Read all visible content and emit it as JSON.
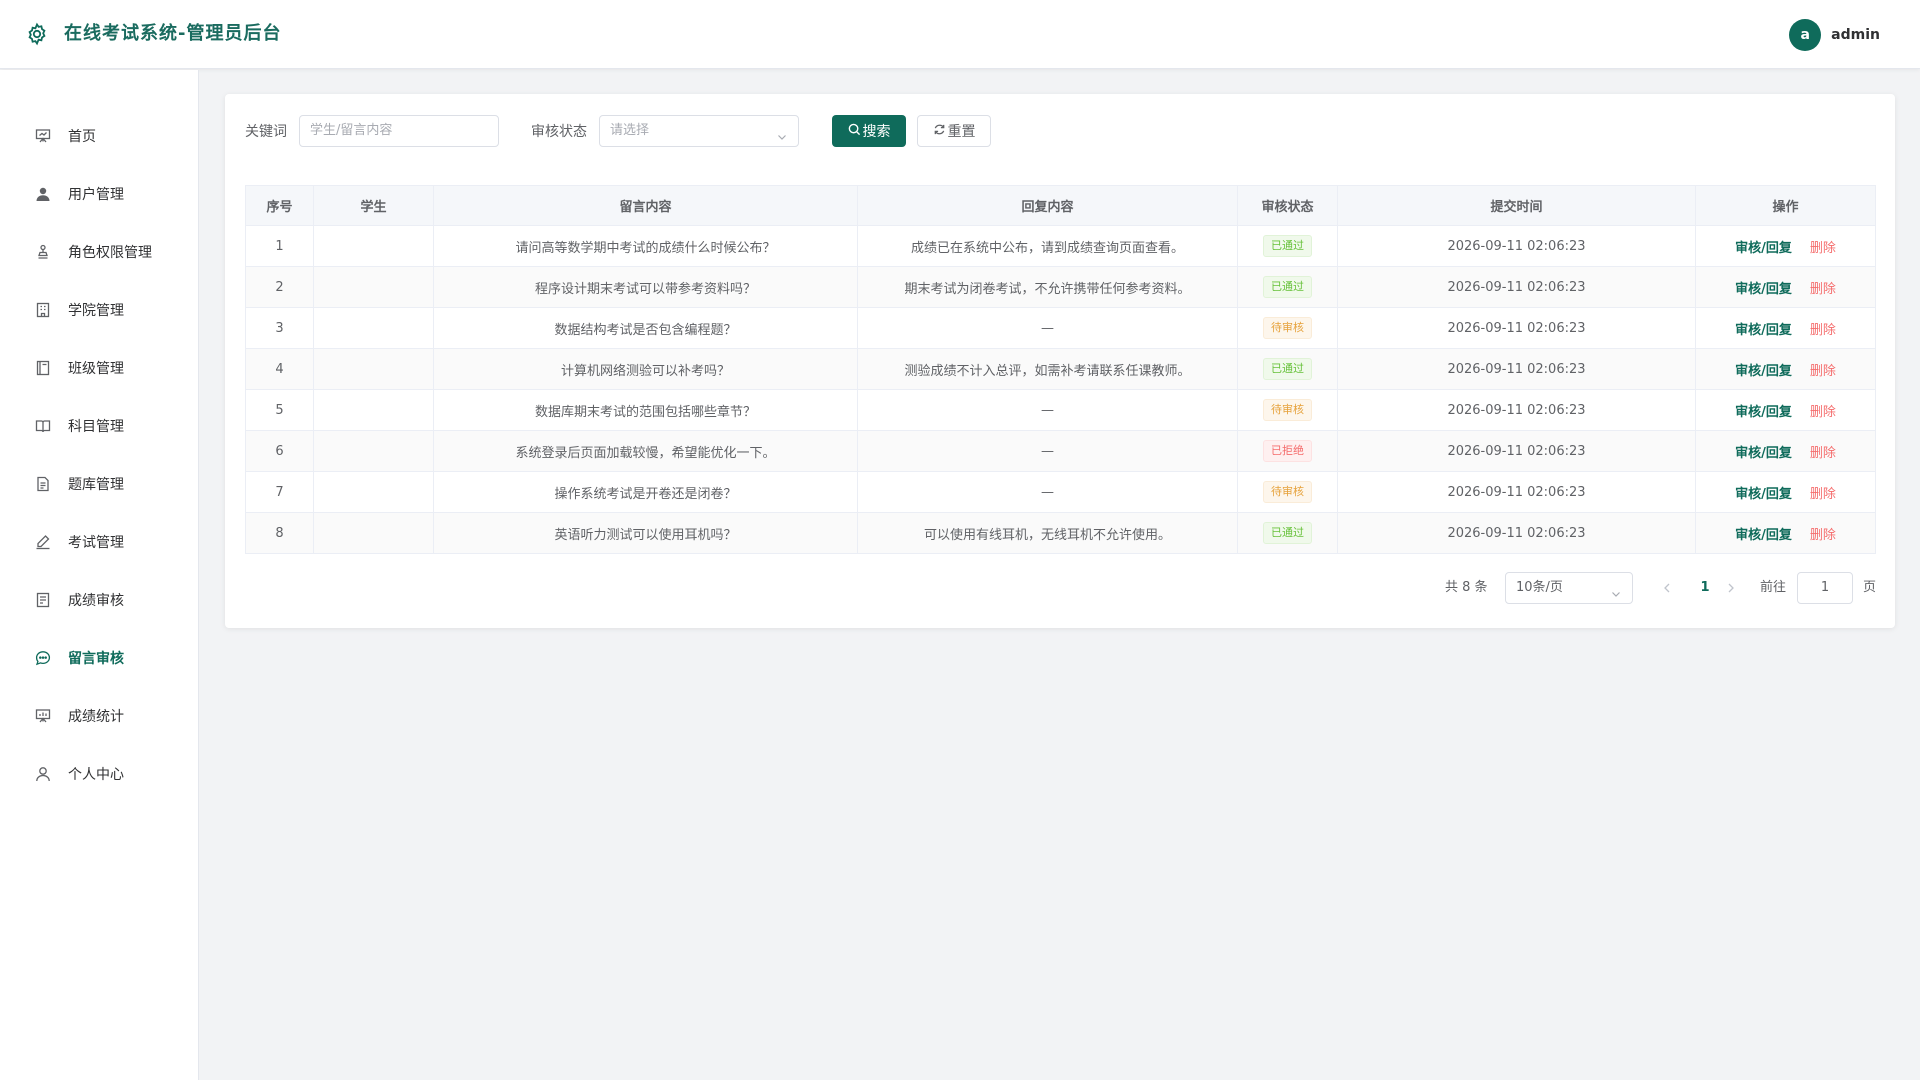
{
  "header": {
    "title": "在线考试系统-管理员后台",
    "avatar_letter": "a",
    "username": "admin"
  },
  "sidebar": {
    "items": [
      {
        "label": "首页",
        "icon": "presentation-board-icon",
        "key": "home"
      },
      {
        "label": "用户管理",
        "icon": "user-filled-icon",
        "key": "users"
      },
      {
        "label": "角色权限管理",
        "icon": "stamp-icon",
        "key": "roles"
      },
      {
        "label": "学院管理",
        "icon": "building-icon",
        "key": "colleges"
      },
      {
        "label": "班级管理",
        "icon": "notebook-icon",
        "key": "classes"
      },
      {
        "label": "科目管理",
        "icon": "open-book-icon",
        "key": "subjects"
      },
      {
        "label": "题库管理",
        "icon": "document-icon",
        "key": "question-bank"
      },
      {
        "label": "考试管理",
        "icon": "edit-pen-icon",
        "key": "exams"
      },
      {
        "label": "成绩审核",
        "icon": "tickets-icon",
        "key": "score-review"
      },
      {
        "label": "留言审核",
        "icon": "chat-dot-icon",
        "key": "message-review"
      },
      {
        "label": "成绩统计",
        "icon": "data-board-icon",
        "key": "score-stats"
      },
      {
        "label": "个人中心",
        "icon": "user-outline-icon",
        "key": "profile"
      }
    ],
    "active_index": 9
  },
  "filters": {
    "keyword_label": "关键词",
    "keyword_placeholder": "学生/留言内容",
    "status_label": "审核状态",
    "status_placeholder": "请选择",
    "search_button": "搜索",
    "reset_button": "重置"
  },
  "table": {
    "columns": [
      "序号",
      "学生",
      "留言内容",
      "回复内容",
      "审核状态",
      "提交时间",
      "操作"
    ],
    "rows": [
      {
        "no": "1",
        "student": "",
        "content": "请问高等数学期中考试的成绩什么时候公布？",
        "reply": "成绩已在系统中公布，请到成绩查询页面查看。",
        "status": "已通过",
        "status_type": "approved",
        "time": "2026-09-11 02:06:23"
      },
      {
        "no": "2",
        "student": "",
        "content": "程序设计期末考试可以带参考资料吗？",
        "reply": "期末考试为闭卷考试，不允许携带任何参考资料。",
        "status": "已通过",
        "status_type": "approved",
        "time": "2026-09-11 02:06:23"
      },
      {
        "no": "3",
        "student": "",
        "content": "数据结构考试是否包含编程题？",
        "reply": "—",
        "status": "待审核",
        "status_type": "pending",
        "time": "2026-09-11 02:06:23"
      },
      {
        "no": "4",
        "student": "",
        "content": "计算机网络测验可以补考吗？",
        "reply": "测验成绩不计入总评，如需补考请联系任课教师。",
        "status": "已通过",
        "status_type": "approved",
        "time": "2026-09-11 02:06:23"
      },
      {
        "no": "5",
        "student": "",
        "content": "数据库期末考试的范围包括哪些章节？",
        "reply": "—",
        "status": "待审核",
        "status_type": "pending",
        "time": "2026-09-11 02:06:23"
      },
      {
        "no": "6",
        "student": "",
        "content": "系统登录后页面加载较慢，希望能优化一下。",
        "reply": "—",
        "status": "已拒绝",
        "status_type": "rejected",
        "time": "2026-09-11 02:06:23"
      },
      {
        "no": "7",
        "student": "",
        "content": "操作系统考试是开卷还是闭卷？",
        "reply": "—",
        "status": "待审核",
        "status_type": "pending",
        "time": "2026-09-11 02:06:23"
      },
      {
        "no": "8",
        "student": "",
        "content": "英语听力测试可以使用耳机吗？",
        "reply": "可以使用有线耳机，无线耳机不允许使用。",
        "status": "已通过",
        "status_type": "approved",
        "time": "2026-09-11 02:06:23"
      }
    ],
    "actions": {
      "review": "审核/回复",
      "delete": "删除"
    }
  },
  "pagination": {
    "total_text": "共 8 条",
    "page_size": "10条/页",
    "current_page": "1",
    "goto_label": "前往",
    "goto_value": "1",
    "unit_label": "页"
  },
  "colors": {
    "primary": "#0f6b5b",
    "approved": "#67c23a",
    "pending": "#e6a23c",
    "rejected": "#f56c6c"
  }
}
